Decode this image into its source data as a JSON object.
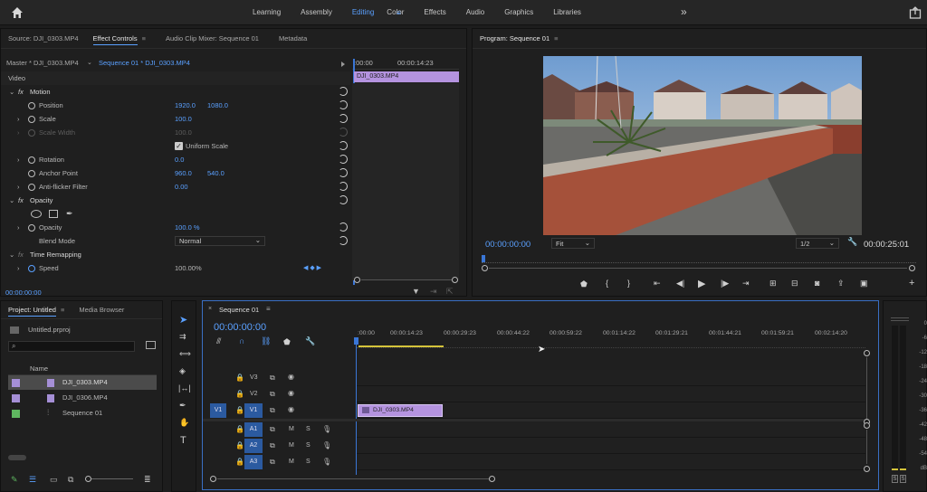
{
  "workspace": {
    "tabs": [
      "Learning",
      "Assembly",
      "Editing",
      "Color",
      "Effects",
      "Audio",
      "Graphics",
      "Libraries"
    ],
    "active": "Editing",
    "more": "»"
  },
  "source_panel": {
    "tabs": [
      "Source: DJI_0303.MP4",
      "Effect Controls",
      "Audio Clip Mixer: Sequence 01",
      "Metadata"
    ],
    "master_label": "Master * DJI_0303.MP4",
    "sequence_label": "Sequence 01 * DJI_0303.MP4",
    "ruler_start": ":00:00",
    "ruler_end": "00:00:14:23",
    "clip_label": "DJI_0303.MP4",
    "section": "Video",
    "rows": [
      {
        "fx": "Motion"
      },
      {
        "name": "Position",
        "v1": "1920.0",
        "v2": "1080.0"
      },
      {
        "name": "Scale",
        "v1": "100.0"
      },
      {
        "name": "Scale Width",
        "v1": "100.0"
      },
      {
        "name": "Uniform Scale"
      },
      {
        "name": "Rotation",
        "v1": "0.0"
      },
      {
        "name": "Anchor Point",
        "v1": "960.0",
        "v2": "540.0"
      },
      {
        "name": "Anti-flicker Filter",
        "v1": "0.00"
      },
      {
        "fx": "Opacity"
      },
      {
        "name": "Opacity",
        "v1": "100.0 %"
      },
      {
        "name": "Blend Mode",
        "v1": "Normal"
      },
      {
        "fx": "Time Remapping"
      },
      {
        "name": "Speed",
        "v1": "100.00%"
      }
    ],
    "timecode": "00:00:00:00"
  },
  "program": {
    "title": "Program: Sequence 01",
    "timecode": "00:00:00:00",
    "fit": "Fit",
    "quality": "1/2",
    "duration": "00:00:25:01"
  },
  "project": {
    "tabs": [
      "Project: Untitled",
      "Media Browser"
    ],
    "file": "Untitled.prproj",
    "col_name": "Name",
    "items": [
      {
        "name": "DJI_0303.MP4",
        "color": "#a58fd6"
      },
      {
        "name": "DJI_0306.MP4",
        "color": "#a58fd6"
      },
      {
        "name": "Sequence 01",
        "color": "#5fb760"
      }
    ]
  },
  "timeline": {
    "title": "Sequence 01",
    "timecode": "00:00:00:00",
    "ticks": [
      ":00:00",
      "00:00:14:23",
      "00:00:29:23",
      "00:00:44:22",
      "00:00:59:22",
      "00:01:14:22",
      "00:01:29:21",
      "00:01:44:21",
      "00:01:59:21",
      "00:02:14:20"
    ],
    "video_tracks": [
      "V3",
      "V2",
      "V1"
    ],
    "audio_tracks": [
      "A1",
      "A2",
      "A3"
    ],
    "source_patch_v": "V1",
    "clip_label": "DJI_0303.MP4",
    "mute": "M",
    "solo": "S"
  },
  "meter": {
    "ticks": [
      "0",
      "-6",
      "-12",
      "-18",
      "-24",
      "-30",
      "-36",
      "-42",
      "-48",
      "-54"
    ],
    "unit": "dB",
    "solo": "S"
  }
}
